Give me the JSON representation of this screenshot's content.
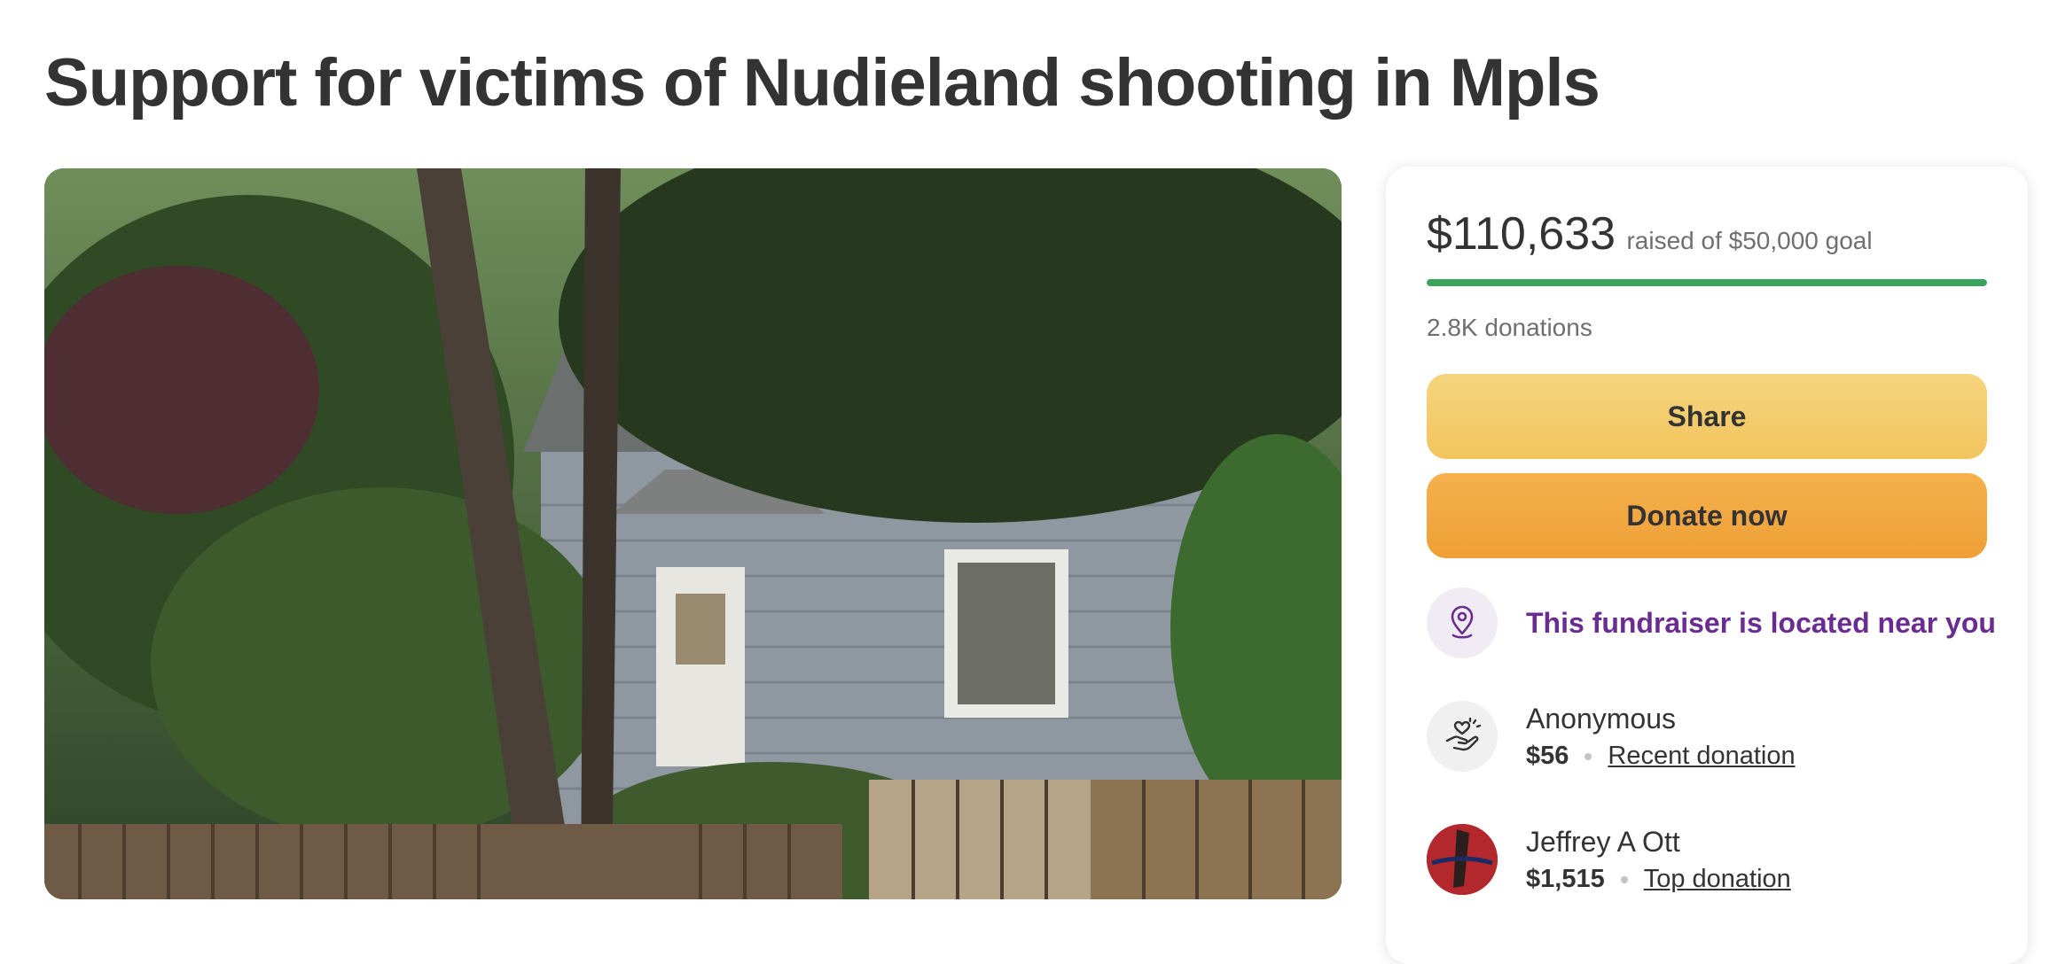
{
  "page": {
    "title": "Support for victims of Nudieland shooting in Mpls"
  },
  "hero_image": {
    "alt": "photo"
  },
  "fundraiser": {
    "raised_amount": "$110,633",
    "raised_text": "raised of $50,000 goal",
    "progress_fraction": 1.0,
    "donations_count": "2.8K donations",
    "share_label": "Share",
    "donate_label": "Donate now",
    "location_text": "This fundraiser is located near you",
    "location_icon": "location-pin-icon"
  },
  "donations": [
    {
      "name": "Anonymous",
      "amount": "$56",
      "label": "Recent donation",
      "icon": "heart-hand-icon"
    },
    {
      "name": "Jeffrey A Ott",
      "amount": "$1,515",
      "label": "Top donation",
      "icon": "avatar"
    }
  ],
  "colors": {
    "progress": "#3aa35c",
    "share": "#f2c45c",
    "donate": "#ef9f36",
    "location_accent": "#6a2c91"
  }
}
